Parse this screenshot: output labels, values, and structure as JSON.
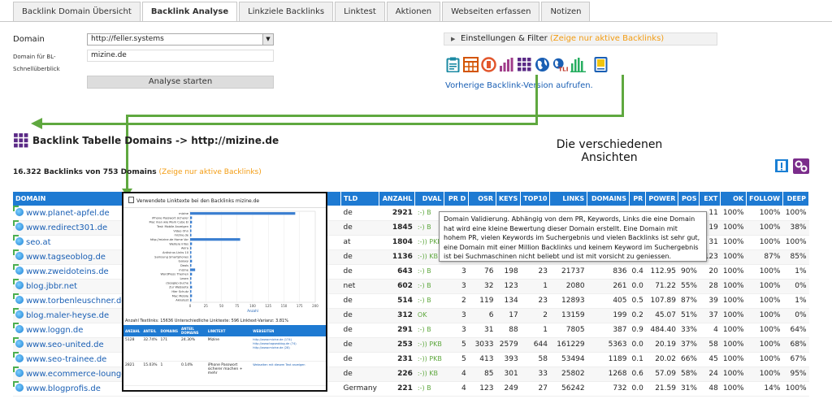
{
  "tabs": [
    {
      "label": "Backlink Domain Übersicht"
    },
    {
      "label": "Backlink Analyse"
    },
    {
      "label": "Linkziele Backlinks"
    },
    {
      "label": "Linktest"
    },
    {
      "label": "Aktionen"
    },
    {
      "label": "Webseiten erfassen"
    },
    {
      "label": "Notizen"
    }
  ],
  "form": {
    "domain_label": "Domain",
    "domain_value": "http://feller.systems",
    "bl_label": "Domain für BL-",
    "bl_label2": "Schnellüberblick",
    "bl_value": "mizine.de",
    "start_button": "Analyse starten"
  },
  "settings": {
    "label": "Einstellungen & Filter",
    "filter_note": "(Zeige nur aktive Backlinks)"
  },
  "prev_version_link": "Vorherige Backlink-Version aufrufen.",
  "annotation": {
    "line1": "Die verschiedenen",
    "line2": "Ansichten"
  },
  "page_title": "Backlink Tabelle Domains -> http://mizine.de",
  "counts": {
    "text": "16.322 Backlinks von 753 Domains",
    "filter_note": "(Zeige nur aktive Backlinks)"
  },
  "table": {
    "headers": [
      "DOMAIN",
      "TLD",
      "ANZAHL",
      "DVAL",
      "PR D",
      "OSR",
      "KEYS",
      "TOP10",
      "LINKS",
      "DOMAINS",
      "PR",
      "POWER",
      "POS",
      "EXT",
      "OK",
      "FOLLOW",
      "DEEP"
    ],
    "rows": [
      {
        "domain": "www.planet-apfel.de",
        "tld": "de",
        "anzahl": "2921",
        "dval": ":-) B",
        "prd": "",
        "osr": "",
        "keys": "",
        "top10": "",
        "links": "",
        "domains": "",
        "pr": "",
        "power": "",
        "pos": "",
        "ext": "11",
        "ok": "100%",
        "follow": "100%",
        "deep": "100%"
      },
      {
        "domain": "www.redirect301.de",
        "tld": "de",
        "anzahl": "1845",
        "dval": ":-) B",
        "prd": "",
        "osr": "",
        "keys": "",
        "top10": "",
        "links": "",
        "domains": "",
        "pr": "",
        "power": "",
        "pos": "",
        "ext": "19",
        "ok": "100%",
        "follow": "100%",
        "deep": "38%"
      },
      {
        "domain": "seo.at",
        "tld": "at",
        "anzahl": "1804",
        "dval": ":-)) PKB",
        "prd": "",
        "osr": "",
        "keys": "",
        "top10": "",
        "links": "",
        "domains": "",
        "pr": "",
        "power": "",
        "pos": "",
        "ext": "31",
        "ok": "100%",
        "follow": "100%",
        "deep": "100%"
      },
      {
        "domain": "www.tagseoblog.de",
        "tld": "de",
        "anzahl": "1136",
        "dval": ":-)) KB",
        "prd": "",
        "osr": "",
        "keys": "",
        "top10": "",
        "links": "",
        "domains": "",
        "pr": "",
        "power": "",
        "pos": "",
        "ext": "123",
        "ok": "100%",
        "follow": "87%",
        "deep": "85%"
      },
      {
        "domain": "www.zweidoteins.de",
        "tld": "de",
        "anzahl": "643",
        "dval": ":-) B",
        "prd": "3",
        "osr": "76",
        "keys": "198",
        "top10": "23",
        "links": "21737",
        "domains": "836",
        "pr": "0.4",
        "power": "112.95",
        "pos": "90%",
        "ext": "20",
        "ok": "100%",
        "follow": "100%",
        "deep": "1%"
      },
      {
        "domain": "blog.jbbr.net",
        "tld": "net",
        "anzahl": "602",
        "dval": ":-) B",
        "prd": "3",
        "osr": "32",
        "keys": "123",
        "top10": "1",
        "links": "2080",
        "domains": "261",
        "pr": "0.0",
        "power": "71.22",
        "pos": "55%",
        "ext": "28",
        "ok": "100%",
        "follow": "100%",
        "deep": "0%"
      },
      {
        "domain": "www.torbenleuschner.de",
        "tld": "de",
        "anzahl": "514",
        "dval": ":-) B",
        "prd": "2",
        "osr": "119",
        "keys": "134",
        "top10": "23",
        "links": "12893",
        "domains": "405",
        "pr": "0.5",
        "power": "107.89",
        "pos": "87%",
        "ext": "39",
        "ok": "100%",
        "follow": "100%",
        "deep": "1%"
      },
      {
        "domain": "blog.maler-heyse.de",
        "tld": "de",
        "anzahl": "312",
        "dval": "OK",
        "prd": "3",
        "osr": "6",
        "keys": "17",
        "top10": "2",
        "links": "13159",
        "domains": "199",
        "pr": "0.2",
        "power": "45.07",
        "pos": "51%",
        "ext": "37",
        "ok": "100%",
        "follow": "100%",
        "deep": "0%"
      },
      {
        "domain": "www.loggn.de",
        "tld": "de",
        "anzahl": "291",
        "dval": ":-) B",
        "prd": "3",
        "osr": "31",
        "keys": "88",
        "top10": "1",
        "links": "7805",
        "domains": "387",
        "pr": "0.9",
        "power": "484.40",
        "pos": "33%",
        "ext": "4",
        "ok": "100%",
        "follow": "100%",
        "deep": "64%"
      },
      {
        "domain": "www.seo-united.de",
        "tld": "de",
        "anzahl": "253",
        "dval": ":-)) PKB",
        "prd": "5",
        "osr": "3033",
        "keys": "2579",
        "top10": "644",
        "links": "161229",
        "domains": "5363",
        "pr": "0.0",
        "power": "20.19",
        "pos": "37%",
        "ext": "58",
        "ok": "100%",
        "follow": "100%",
        "deep": "68%"
      },
      {
        "domain": "www.seo-trainee.de",
        "tld": "de",
        "anzahl": "231",
        "dval": ":-)) PKB",
        "prd": "5",
        "osr": "413",
        "keys": "393",
        "top10": "58",
        "links": "53494",
        "domains": "1189",
        "pr": "0.1",
        "power": "20.02",
        "pos": "66%",
        "ext": "45",
        "ok": "100%",
        "follow": "100%",
        "deep": "67%"
      },
      {
        "domain": "www.ecommerce-lounge.de",
        "tld": "de",
        "anzahl": "226",
        "dval": ":-)) KB",
        "prd": "4",
        "osr": "85",
        "keys": "301",
        "top10": "33",
        "links": "25802",
        "domains": "1268",
        "pr": "0.6",
        "power": "57.09",
        "pos": "58%",
        "ext": "24",
        "ok": "100%",
        "follow": "100%",
        "deep": "95%"
      },
      {
        "domain": "www.blogprofis.de",
        "tld": "Germany",
        "anzahl": "221",
        "dval": ":-) B",
        "prd": "4",
        "osr": "123",
        "keys": "249",
        "top10": "27",
        "links": "56242",
        "domains": "732",
        "pr": "0.0",
        "power": "21.59",
        "pos": "31%",
        "ext": "48",
        "ok": "100%",
        "follow": "14%",
        "deep": "100%"
      }
    ]
  },
  "tooltip": "Domain Validierung. Abhängig von dem PR, Keywords, Links die eine Domain hat wird eine kleine Bewertung dieser Domain erstellt. Eine Domain mit hohem PR, vielen Keywords im Suchergebnis und vielen Backlinks ist sehr gut, eine Domain mit einer Million Backlinks und keinem Keyword im Suchergebnis ist bei Suchmaschinen nicht beliebt und ist mit vorsicht zu geniessen.",
  "panel": {
    "title": "Verwendete Linktexte bei den Backlinks mizine.de",
    "stats": "Anzahl Textlinks: 15636   Unterschiedliche Linktexte: 596   Linktext-Varianz: 3.81%",
    "chart_labels": [
      "mizine",
      "iPhone Passwort sicherer",
      "Mac man wie Mark Cube Ei",
      "Test: Mobile Anzeigen",
      "Video Ohn",
      "mizine.de",
      "http://mizine.de Home Vor",
      "Weitere Infos",
      "Avira",
      "Antivirus Links 10",
      "Samsung Smartphones",
      "Galaxy",
      "Deals",
      "mizine",
      "WordPress Themen",
      "Lesen",
      "(Google)-Suche",
      "Zur Webseite",
      "Hier Schutz",
      "Mac Mobile",
      "Akkutest"
    ],
    "chart_values": [
      168,
      3,
      3,
      2,
      2,
      2,
      80,
      3,
      2,
      2,
      2,
      3,
      2,
      8,
      3,
      2,
      2,
      3,
      2,
      3,
      2
    ],
    "ticks": [
      "0",
      "25",
      "50",
      "75",
      "100",
      "125",
      "150",
      "175",
      "200"
    ],
    "axis_label": "Anzahl",
    "table_headers": [
      "ANZAHL",
      "ANTEIL",
      "DOMAINS",
      "ANTEIL DOMAINS",
      "LINKTEXT",
      "WEBSEITEN"
    ],
    "table_rows": [
      {
        "anzahl": "5128",
        "anteil": "32.74%",
        "domains": "171",
        "anteil_dom": "24.30%",
        "linktext": "Mizine",
        "webseiten": "http://www.mizine.de (174) http://www.tagseoblog.de (74) http://www.mizine.de (28)"
      },
      {
        "anzahl": "2821",
        "anteil": "15.03%",
        "domains": "1",
        "anteil_dom": "0.14%",
        "linktext": "iPhone Passwort sicherer machen + mehr",
        "webseiten": "Webseiten mit diesem Text anzeigen"
      }
    ]
  }
}
